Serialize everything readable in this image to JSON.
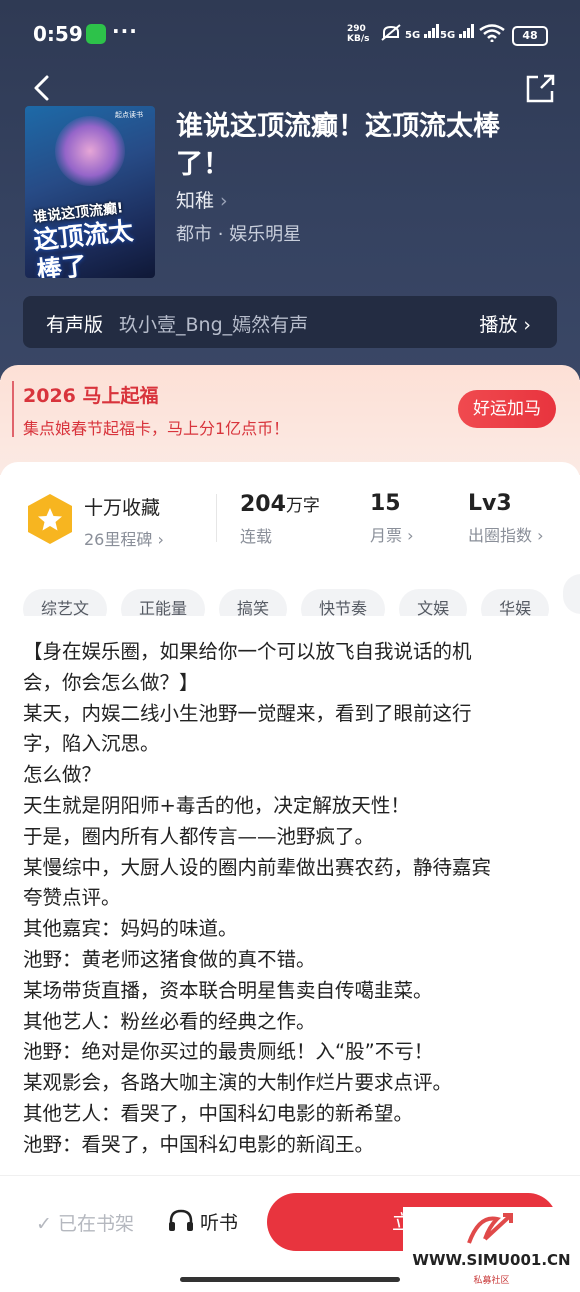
{
  "status": {
    "time": "0:59",
    "more": "···",
    "speed_top": "290",
    "speed_bottom": "KB/s",
    "sig1": "5G",
    "sig2": "5G",
    "battery": "48"
  },
  "book": {
    "title": "谁说这顶流癫！这顶流太棒了！",
    "author": "知稚",
    "genre": "都市 · 娱乐明星",
    "cover": {
      "publisher": "起点读书",
      "line1": "谁说这顶流癫!",
      "line2": "这顶流太棒了"
    }
  },
  "audio": {
    "label": "有声版",
    "narrators": "玖小壹_Bng_嫣然有声",
    "play": "播放"
  },
  "promo": {
    "heading": "2026 马上起福",
    "sub": "集点娘春节起福卡，马上分1亿点币！",
    "button": "好运加马"
  },
  "stats": {
    "collect": "十万收藏",
    "milestone": "26里程碑",
    "words_num": "204",
    "words_unit": "万字",
    "words_status": "连载",
    "tickets": "15",
    "tickets_label": "月票",
    "level": "Lv3",
    "level_label": "出圈指数"
  },
  "tags": [
    "综艺文",
    "正能量",
    "搞笑",
    "快节奏",
    "文娱",
    "华娱"
  ],
  "description": [
    "【身在娱乐圈，如果给你一个可以放飞自我说话的机",
    "会，你会怎么做？】",
    "某天，内娱二线小生池野一觉醒来，看到了眼前这行",
    "字，陷入沉思。",
    "怎么做？",
    "天生就是阴阳师+毒舌的他，决定解放天性！",
    "于是，圈内所有人都传言——池野疯了。",
    "某慢综中，大厨人设的圈内前辈做出赛农药，静待嘉宾",
    "夸赞点评。",
    "其他嘉宾：妈妈的味道。",
    "池野：黄老师这猪食做的真不错。",
    "某场带货直播，资本联合明星售卖自传噶韭菜。",
    "其他艺人：粉丝必看的经典之作。",
    "池野：绝对是你买过的最贵厕纸！入“股”不亏！",
    "某观影会，各路大咖主演的大制作烂片要求点评。",
    "其他艺人：看哭了，中国科幻电影的新希望。",
    "池野：看哭了，中国科幻电影的新阎王。"
  ],
  "bottom": {
    "shelf": "已在书架",
    "listen": "听书",
    "read": "立即"
  },
  "watermark": {
    "url": "WWW.SIMU001.CN",
    "sub": "私募社区"
  },
  "colors": {
    "accent": "#e8343e",
    "hero_bg": "#354260"
  }
}
